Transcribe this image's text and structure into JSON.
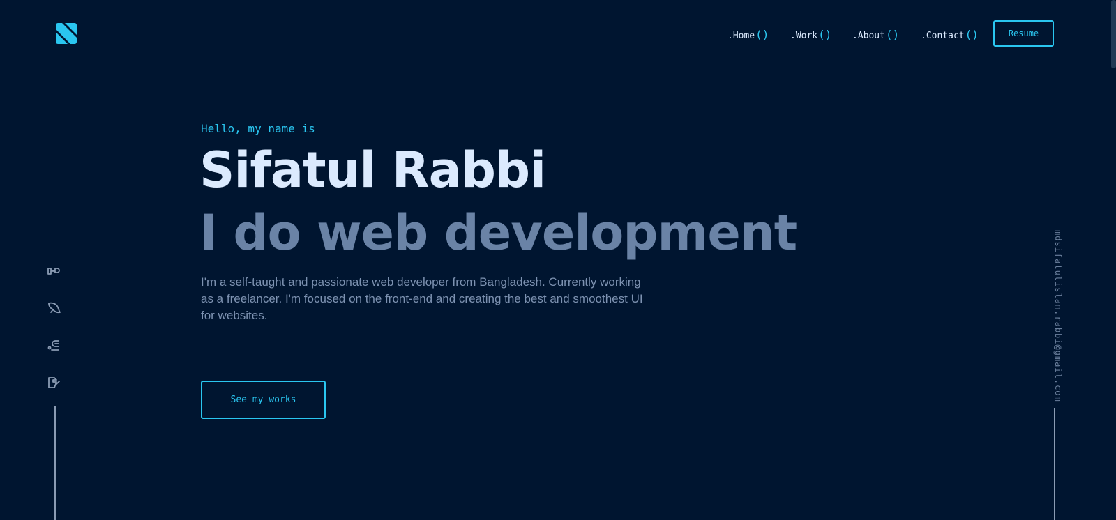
{
  "header": {
    "logo_icon": "s-logo-icon",
    "nav": [
      {
        "label": ".Home",
        "paren": "()"
      },
      {
        "label": ".Work",
        "paren": "()"
      },
      {
        "label": ".About",
        "paren": "()"
      },
      {
        "label": ".Contact",
        "paren": "()"
      }
    ],
    "resume_label": "Resume"
  },
  "hero": {
    "greeting": "Hello, my name is",
    "name": "Sifatul Rabbi",
    "tagline": "I do web development",
    "bio": "I'm a self-taught and passionate web developer from Bangladesh. Currently working as a freelancer. I'm focused on the front-end and creating the best and smoothest UI for websites.",
    "cta_label": "See my works"
  },
  "sidebar": {
    "social_icons": [
      "social-icon-1",
      "social-icon-2",
      "social-icon-3",
      "social-icon-4"
    ],
    "email": "mdsifatulislam.rabbi@gmail.com"
  },
  "colors": {
    "background": "#001530",
    "accent": "#2ac6f0",
    "heading": "#dbeafe",
    "tagline": "#6a83a6",
    "body_text": "#7d92b1"
  }
}
